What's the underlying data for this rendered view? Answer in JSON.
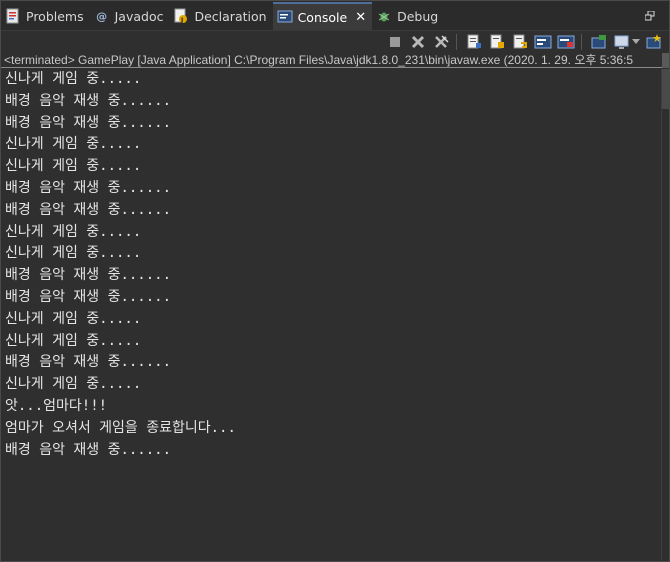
{
  "tabs": [
    {
      "label": "Problems",
      "icon": "problems-icon",
      "active": false
    },
    {
      "label": "Javadoc",
      "icon": "javadoc-icon",
      "active": false
    },
    {
      "label": "Declaration",
      "icon": "declaration-icon",
      "active": false
    },
    {
      "label": "Console",
      "icon": "console-icon",
      "active": true
    },
    {
      "label": "Debug",
      "icon": "debug-icon",
      "active": false
    }
  ],
  "close_glyph": "✕",
  "status": "<terminated> GamePlay [Java Application] C:\\Program Files\\Java\\jdk1.8.0_231\\bin\\javaw.exe (2020. 1. 29. 오후 5:36:5",
  "console_lines": [
    "신나게 게임 중.....",
    "배경 음악 재생 중......",
    "배경 음악 재생 중......",
    "신나게 게임 중.....",
    "신나게 게임 중.....",
    "배경 음악 재생 중......",
    "배경 음악 재생 중......",
    "신나게 게임 중.....",
    "신나게 게임 중.....",
    "배경 음악 재생 중......",
    "배경 음악 재생 중......",
    "신나게 게임 중.....",
    "신나게 게임 중.....",
    "배경 음악 재생 중......",
    "신나게 게임 중.....",
    "앗...엄마다!!!",
    "엄마가 오셔서 게임을 종료합니다...",
    "배경 음악 재생 중......"
  ],
  "toolbar_icons": [
    "terminate-icon",
    "remove-launch-icon",
    "remove-all-terminated-icon",
    "clear-console-icon",
    "scroll-lock-icon",
    "word-wrap-icon",
    "show-on-stdout-icon",
    "show-on-stderr-icon",
    "pin-console-icon",
    "display-selected-console-icon",
    "open-console-icon"
  ]
}
